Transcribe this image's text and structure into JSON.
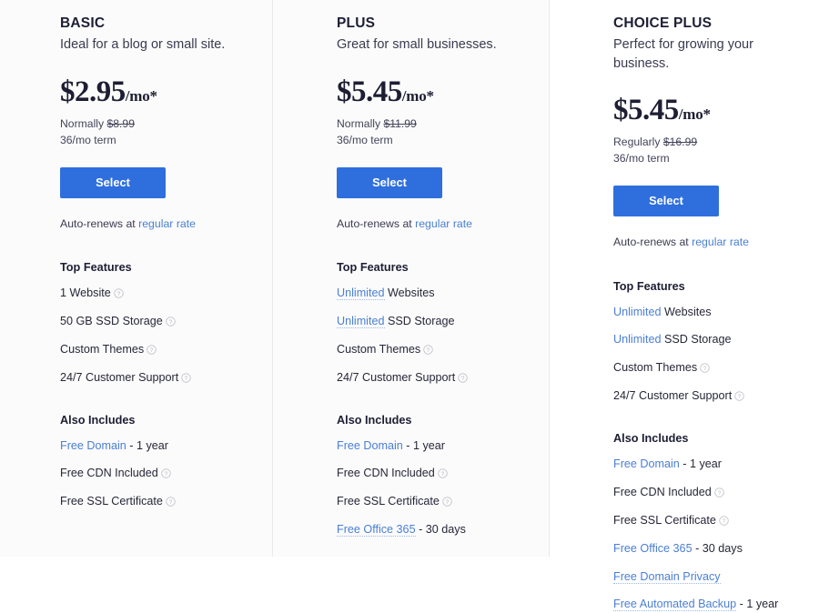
{
  "accent": {
    "button_blue": "#2f6fdd",
    "link_blue": "#4a7fd4",
    "text_dark": "#1d1e33",
    "divider": "#e9e9ec",
    "column_bg": "#fbfbfb"
  },
  "labels": {
    "top_features": "Top Features",
    "also_includes": "Also Includes",
    "select": "Select",
    "autorenew_prefix": "Auto-renews at ",
    "regular_rate": "regular rate",
    "help_icon": "help-circle-icon"
  },
  "plans": [
    {
      "id": "basic",
      "name": "BASIC",
      "tagline": "Ideal for a blog or small site.",
      "price": "$2.95",
      "period": "/mo*",
      "normally_label": "Normally",
      "normally_price": "$8.99",
      "term": "36/mo term",
      "select_label": "Select",
      "autorenew_prefix": "Auto-renews at ",
      "autorenew_link": "regular rate",
      "top_features_title": "Top Features",
      "top_features": [
        {
          "lead": "",
          "lead_style": "none",
          "text": "1 Website",
          "help": true
        },
        {
          "lead": "",
          "lead_style": "none",
          "text": "50 GB SSD Storage",
          "help": true
        },
        {
          "lead": "",
          "lead_style": "none",
          "text": "Custom Themes",
          "help": true
        },
        {
          "lead": "",
          "lead_style": "none",
          "text": "24/7 Customer Support",
          "help": true
        }
      ],
      "also_includes_title": "Also Includes",
      "also_includes": [
        {
          "lead": "Free Domain",
          "lead_style": "link",
          "text": " - 1 year",
          "help": false
        },
        {
          "lead": "",
          "lead_style": "none",
          "text": "Free CDN Included",
          "help": true
        },
        {
          "lead": "",
          "lead_style": "none",
          "text": "Free SSL Certificate",
          "help": true
        }
      ]
    },
    {
      "id": "plus",
      "name": "PLUS",
      "tagline": "Great for small businesses.",
      "price": "$5.45",
      "period": "/mo*",
      "normally_label": "Normally",
      "normally_price": "$11.99",
      "term": "36/mo term",
      "select_label": "Select",
      "autorenew_prefix": "Auto-renews at ",
      "autorenew_link": "regular rate",
      "top_features_title": "Top Features",
      "top_features": [
        {
          "lead": "Unlimited",
          "lead_style": "tip",
          "text": " Websites",
          "help": false
        },
        {
          "lead": "Unlimited",
          "lead_style": "tip",
          "text": " SSD Storage",
          "help": false
        },
        {
          "lead": "",
          "lead_style": "none",
          "text": "Custom Themes",
          "help": true
        },
        {
          "lead": "",
          "lead_style": "none",
          "text": "24/7 Customer Support",
          "help": true
        }
      ],
      "also_includes_title": "Also Includes",
      "also_includes": [
        {
          "lead": "Free Domain",
          "lead_style": "link",
          "text": " - 1 year",
          "help": false
        },
        {
          "lead": "",
          "lead_style": "none",
          "text": "Free CDN Included",
          "help": true
        },
        {
          "lead": "",
          "lead_style": "none",
          "text": "Free SSL Certificate",
          "help": true
        },
        {
          "lead": "Free Office 365",
          "lead_style": "tip",
          "text": " - 30 days",
          "help": false
        }
      ]
    },
    {
      "id": "choice-plus",
      "name": "CHOICE PLUS",
      "tagline": "Perfect for growing your business.",
      "price": "$5.45",
      "period": "/mo*",
      "normally_label": "Regularly",
      "normally_price": "$16.99",
      "term": "36/mo term",
      "select_label": "Select",
      "autorenew_prefix": "Auto-renews at ",
      "autorenew_link": "regular rate",
      "top_features_title": "Top Features",
      "top_features": [
        {
          "lead": "Unlimited",
          "lead_style": "link",
          "text": " Websites",
          "help": false
        },
        {
          "lead": "Unlimited",
          "lead_style": "link",
          "text": " SSD Storage",
          "help": false
        },
        {
          "lead": "",
          "lead_style": "none",
          "text": "Custom Themes",
          "help": true
        },
        {
          "lead": "",
          "lead_style": "none",
          "text": "24/7 Customer Support",
          "help": true
        }
      ],
      "also_includes_title": "Also Includes",
      "also_includes": [
        {
          "lead": "Free Domain",
          "lead_style": "link",
          "text": " - 1 year",
          "help": false
        },
        {
          "lead": "",
          "lead_style": "none",
          "text": "Free CDN Included",
          "help": true
        },
        {
          "lead": "",
          "lead_style": "none",
          "text": "Free SSL Certificate",
          "help": true
        },
        {
          "lead": "Free Office 365",
          "lead_style": "link",
          "text": " - 30 days",
          "help": false
        },
        {
          "lead": "Free Domain Privacy",
          "lead_style": "tip",
          "text": "",
          "help": false
        },
        {
          "lead": "Free Automated Backup",
          "lead_style": "tip",
          "text": " - 1 year",
          "help": false
        }
      ]
    }
  ]
}
